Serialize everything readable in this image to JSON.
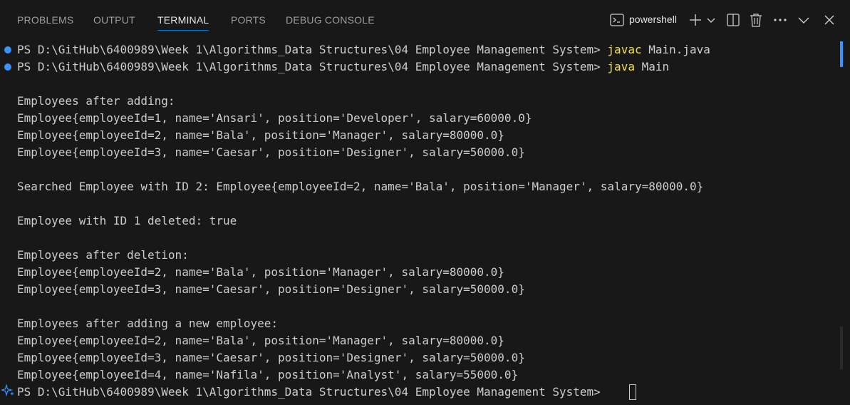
{
  "tabs": [
    {
      "label": "PROBLEMS",
      "active": false
    },
    {
      "label": "OUTPUT",
      "active": false
    },
    {
      "label": "TERMINAL",
      "active": true
    },
    {
      "label": "PORTS",
      "active": false
    },
    {
      "label": "DEBUG CONSOLE",
      "active": false
    }
  ],
  "toolbar": {
    "shell_label": "powershell",
    "icons": [
      "terminal-icon",
      "add-icon",
      "chevron-down-icon",
      "split-icon",
      "trash-icon",
      "more-icon",
      "chevron-down-icon",
      "close-icon"
    ]
  },
  "terminal": {
    "prompt": "PS D:\\GitHub\\6400989\\Week 1\\Algorithms_Data Structures\\04 Employee Management System> ",
    "command1": "javac",
    "command1_args": " Main.java",
    "command2": "java",
    "command2_args": " Main",
    "output": [
      "",
      "Employees after adding:",
      "Employee{employeeId=1, name='Ansari', position='Developer', salary=60000.0}",
      "Employee{employeeId=2, name='Bala', position='Manager', salary=80000.0}",
      "Employee{employeeId=3, name='Caesar', position='Designer', salary=50000.0}",
      "",
      "Searched Employee with ID 2: Employee{employeeId=2, name='Bala', position='Manager', salary=80000.0}",
      "",
      "Employee with ID 1 deleted: true",
      "",
      "Employees after deletion:",
      "Employee{employeeId=2, name='Bala', position='Manager', salary=80000.0}",
      "Employee{employeeId=3, name='Caesar', position='Designer', salary=50000.0}",
      "",
      "Employees after adding a new employee:",
      "Employee{employeeId=2, name='Bala', position='Manager', salary=80000.0}",
      "Employee{employeeId=3, name='Caesar', position='Designer', salary=50000.0}",
      "Employee{employeeId=4, name='Nafila', position='Analyst', salary=55000.0}"
    ],
    "final_prompt": "PS D:\\GitHub\\6400989\\Week 1\\Algorithms_Data Structures\\04 Employee Management System> "
  },
  "colors": {
    "background": "#181818",
    "text": "#cccccc",
    "command": "#f2e14a",
    "accent": "#0078d4",
    "dot": "#3794ff"
  }
}
